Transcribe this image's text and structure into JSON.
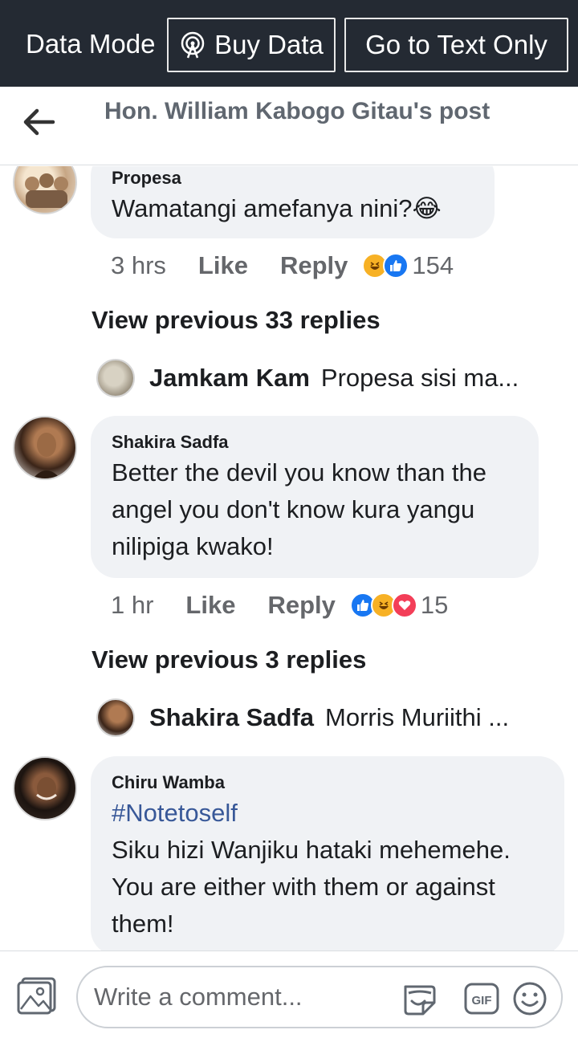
{
  "databar": {
    "mode_label": "Data Mode",
    "buy_label": "Buy Data",
    "text_only_label": "Go to Text Only"
  },
  "header": {
    "title": "Hon. William Kabogo Gitau's post"
  },
  "comments": [
    {
      "author": "Propesa",
      "text": "Wamatangi amefanya nini?😂",
      "time": "3 hrs",
      "like_label": "Like",
      "reply_label": "Reply",
      "reaction_count": "154",
      "reactions": [
        "haha",
        "like"
      ],
      "view_previous": "View previous 33 replies",
      "latest_reply": {
        "author": "Jamkam Kam",
        "snippet": "Propesa sisi ma..."
      }
    },
    {
      "author": "Shakira Sadfa",
      "text": "Better the devil you know than the angel you don't know kura yangu nilipiga kwako!",
      "time": "1 hr",
      "like_label": "Like",
      "reply_label": "Reply",
      "reaction_count": "15",
      "reactions": [
        "like",
        "haha",
        "love"
      ],
      "view_previous": "View previous 3 replies",
      "latest_reply": {
        "author": "Shakira Sadfa",
        "snippet": "Morris Muriithi ..."
      }
    },
    {
      "author": "Chiru Wamba",
      "hashtag": "#Notetoself",
      "text": "Siku hizi Wanjiku hataki mehemehe. You are either with them or against them!"
    }
  ],
  "composer": {
    "placeholder": "Write a comment..."
  },
  "colors": {
    "databar_bg": "#242a33",
    "bubble_bg": "#f0f2f5",
    "link_blue": "#385898",
    "like_blue": "#1877f2",
    "haha_yellow": "#f7b125",
    "love_red": "#f33e58"
  }
}
